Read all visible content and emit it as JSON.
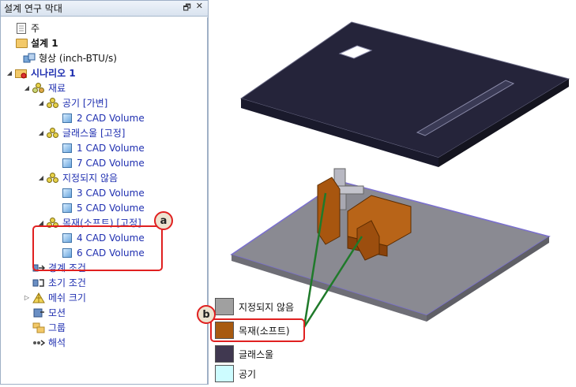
{
  "panel": {
    "title": "설계 연구 막대",
    "pin": "🗗",
    "close": "✕"
  },
  "tree": [
    {
      "label": "주",
      "icon": "document-icon",
      "blue": false,
      "bold": false
    },
    {
      "label": "설계 1",
      "icon": "design-folder-icon",
      "blue": false,
      "bold": true
    },
    {
      "label": "형상 (inch-BTU/s)",
      "icon": "geometry-icon",
      "blue": false,
      "bold": false
    },
    {
      "label": "시나리오 1",
      "icon": "scenario-icon",
      "blue": true,
      "bold": true
    },
    {
      "label": "재료",
      "icon": "materials-icon",
      "blue": true,
      "bold": false
    },
    {
      "label": "공기 [가변]",
      "icon": "material-icon",
      "blue": true,
      "bold": false
    },
    {
      "label": "2 CAD Volume",
      "icon": "cad-volume-icon",
      "blue": true,
      "bold": false
    },
    {
      "label": "글래스울 [고정]",
      "icon": "material-icon",
      "blue": true,
      "bold": false
    },
    {
      "label": "1 CAD Volume",
      "icon": "cad-volume-icon",
      "blue": true,
      "bold": false
    },
    {
      "label": "7 CAD Volume",
      "icon": "cad-volume-icon",
      "blue": true,
      "bold": false
    },
    {
      "label": "지정되지 않음",
      "icon": "material-icon",
      "blue": true,
      "bold": false
    },
    {
      "label": "3 CAD Volume",
      "icon": "cad-volume-icon",
      "blue": true,
      "bold": false
    },
    {
      "label": "5 CAD Volume",
      "icon": "cad-volume-icon",
      "blue": true,
      "bold": false
    },
    {
      "label": "목재(소프트) [고정]",
      "icon": "material-icon",
      "blue": true,
      "bold": false
    },
    {
      "label": "4 CAD Volume",
      "icon": "cad-volume-icon",
      "blue": true,
      "bold": false
    },
    {
      "label": "6 CAD Volume",
      "icon": "cad-volume-icon",
      "blue": true,
      "bold": false
    },
    {
      "label": "경계 조건",
      "icon": "boundary-conditions-icon",
      "blue": true,
      "bold": false
    },
    {
      "label": "초기 조건",
      "icon": "initial-conditions-icon",
      "blue": true,
      "bold": false
    },
    {
      "label": "메쉬 크기",
      "icon": "mesh-size-icon",
      "blue": true,
      "bold": false
    },
    {
      "label": "모션",
      "icon": "motion-icon",
      "blue": true,
      "bold": false
    },
    {
      "label": "그룹",
      "icon": "groups-icon",
      "blue": true,
      "bold": false
    },
    {
      "label": "해석",
      "icon": "solve-icon",
      "blue": true,
      "bold": false
    }
  ],
  "callouts": {
    "a": "a",
    "b": "b"
  },
  "legend": [
    {
      "label": "지정되지 않음",
      "color": "#a0a0a0"
    },
    {
      "label": "목재(소프트)",
      "color": "#a85a10"
    },
    {
      "label": "글래스울",
      "color": "#403850"
    },
    {
      "label": "공기",
      "color": "#cdfcff"
    }
  ]
}
